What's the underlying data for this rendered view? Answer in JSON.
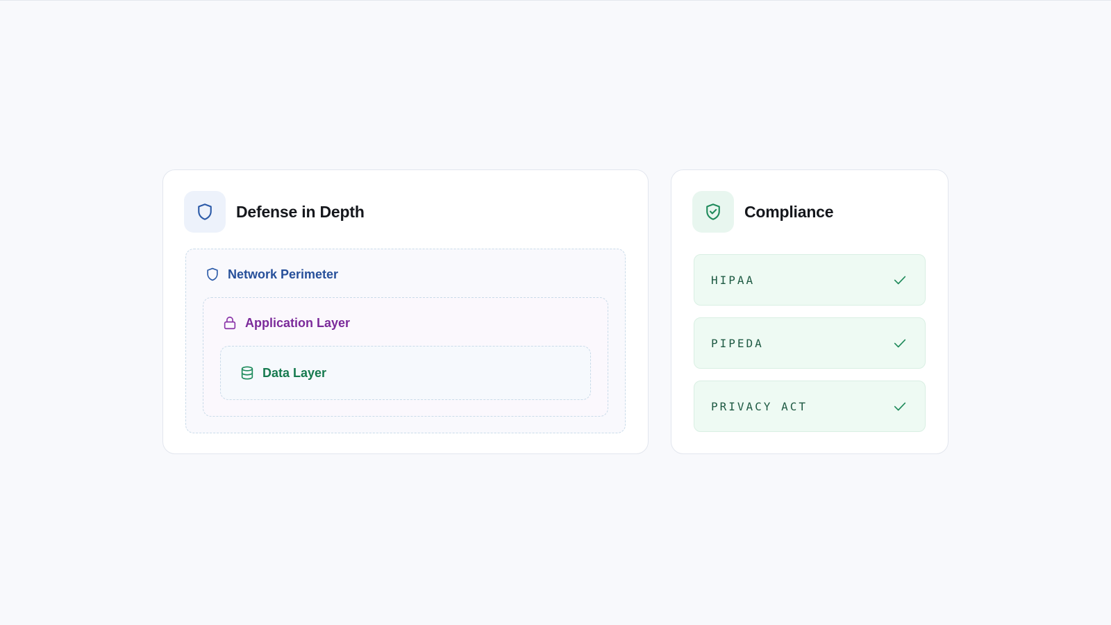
{
  "colors": {
    "background": "#f8f9fc",
    "network_accent": "#27509a",
    "application_accent": "#7b2a9a",
    "data_accent": "#167a4f",
    "compliance_accent": "#1f8a5b"
  },
  "defense": {
    "title": "Defense in Depth",
    "icon": "shield-icon",
    "layers": {
      "network": {
        "label": "Network Perimeter",
        "icon": "shield-icon"
      },
      "application": {
        "label": "Application Layer",
        "icon": "lock-icon"
      },
      "data": {
        "label": "Data Layer",
        "icon": "database-icon"
      }
    }
  },
  "compliance": {
    "title": "Compliance",
    "icon": "shield-check-icon",
    "items": [
      {
        "label": "HIPAA",
        "icon": "check-icon"
      },
      {
        "label": "PIPEDA",
        "icon": "check-icon"
      },
      {
        "label": "PRIVACY ACT",
        "icon": "check-icon"
      }
    ]
  }
}
